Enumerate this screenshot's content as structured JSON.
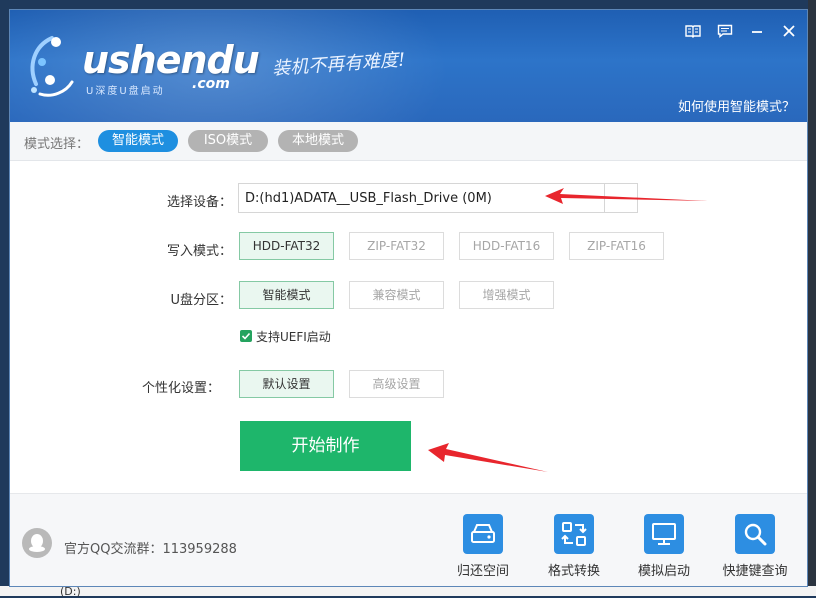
{
  "header": {
    "logo_text": "ushendu",
    "logo_subtitle": "U深度U盘启动",
    "logo_domain": ".com",
    "slogan": "装机不再有难度!",
    "smart_mode_link": "如何使用智能模式？"
  },
  "modebar": {
    "label": "模式选择：",
    "tabs": [
      {
        "label": "智能模式",
        "active": true
      },
      {
        "label": "ISO模式",
        "active": false
      },
      {
        "label": "本地模式",
        "active": false
      }
    ]
  },
  "form": {
    "device_label": "选择设备：",
    "device_value": "D:(hd1)ADATA__USB_Flash_Drive (0M)",
    "write_mode_label": "写入模式：",
    "write_modes": [
      {
        "label": "HDD-FAT32",
        "selected": true
      },
      {
        "label": "ZIP-FAT32",
        "selected": false
      },
      {
        "label": "HDD-FAT16",
        "selected": false
      },
      {
        "label": "ZIP-FAT16",
        "selected": false
      }
    ],
    "partition_label": "U盘分区：",
    "partitions": [
      {
        "label": "智能模式",
        "selected": true
      },
      {
        "label": "兼容模式",
        "selected": false
      },
      {
        "label": "增强模式",
        "selected": false
      }
    ],
    "uefi_label": "支持UEFI启动",
    "uefi_checked": true,
    "personal_label": "个性化设置：",
    "personal_options": [
      {
        "label": "默认设置",
        "selected": true
      },
      {
        "label": "高级设置",
        "selected": false
      }
    ],
    "start_label": "开始制作"
  },
  "footer": {
    "qq_text": "官方QQ交流群：113959288",
    "tools": [
      {
        "label": "归还空间",
        "icon": "hard-drive-icon"
      },
      {
        "label": "格式转换",
        "icon": "convert-icon"
      },
      {
        "label": "模拟启动",
        "icon": "monitor-icon"
      },
      {
        "label": "快捷键查询",
        "icon": "search-icon"
      }
    ]
  },
  "desktop": {
    "bottom_text": "(D:)"
  },
  "colors": {
    "header": "#2d74c9",
    "accent_blue": "#1e8fe0",
    "tab_inactive": "#b3b3b3",
    "start_green": "#1eb66b",
    "arrow_red": "#e8262d"
  }
}
